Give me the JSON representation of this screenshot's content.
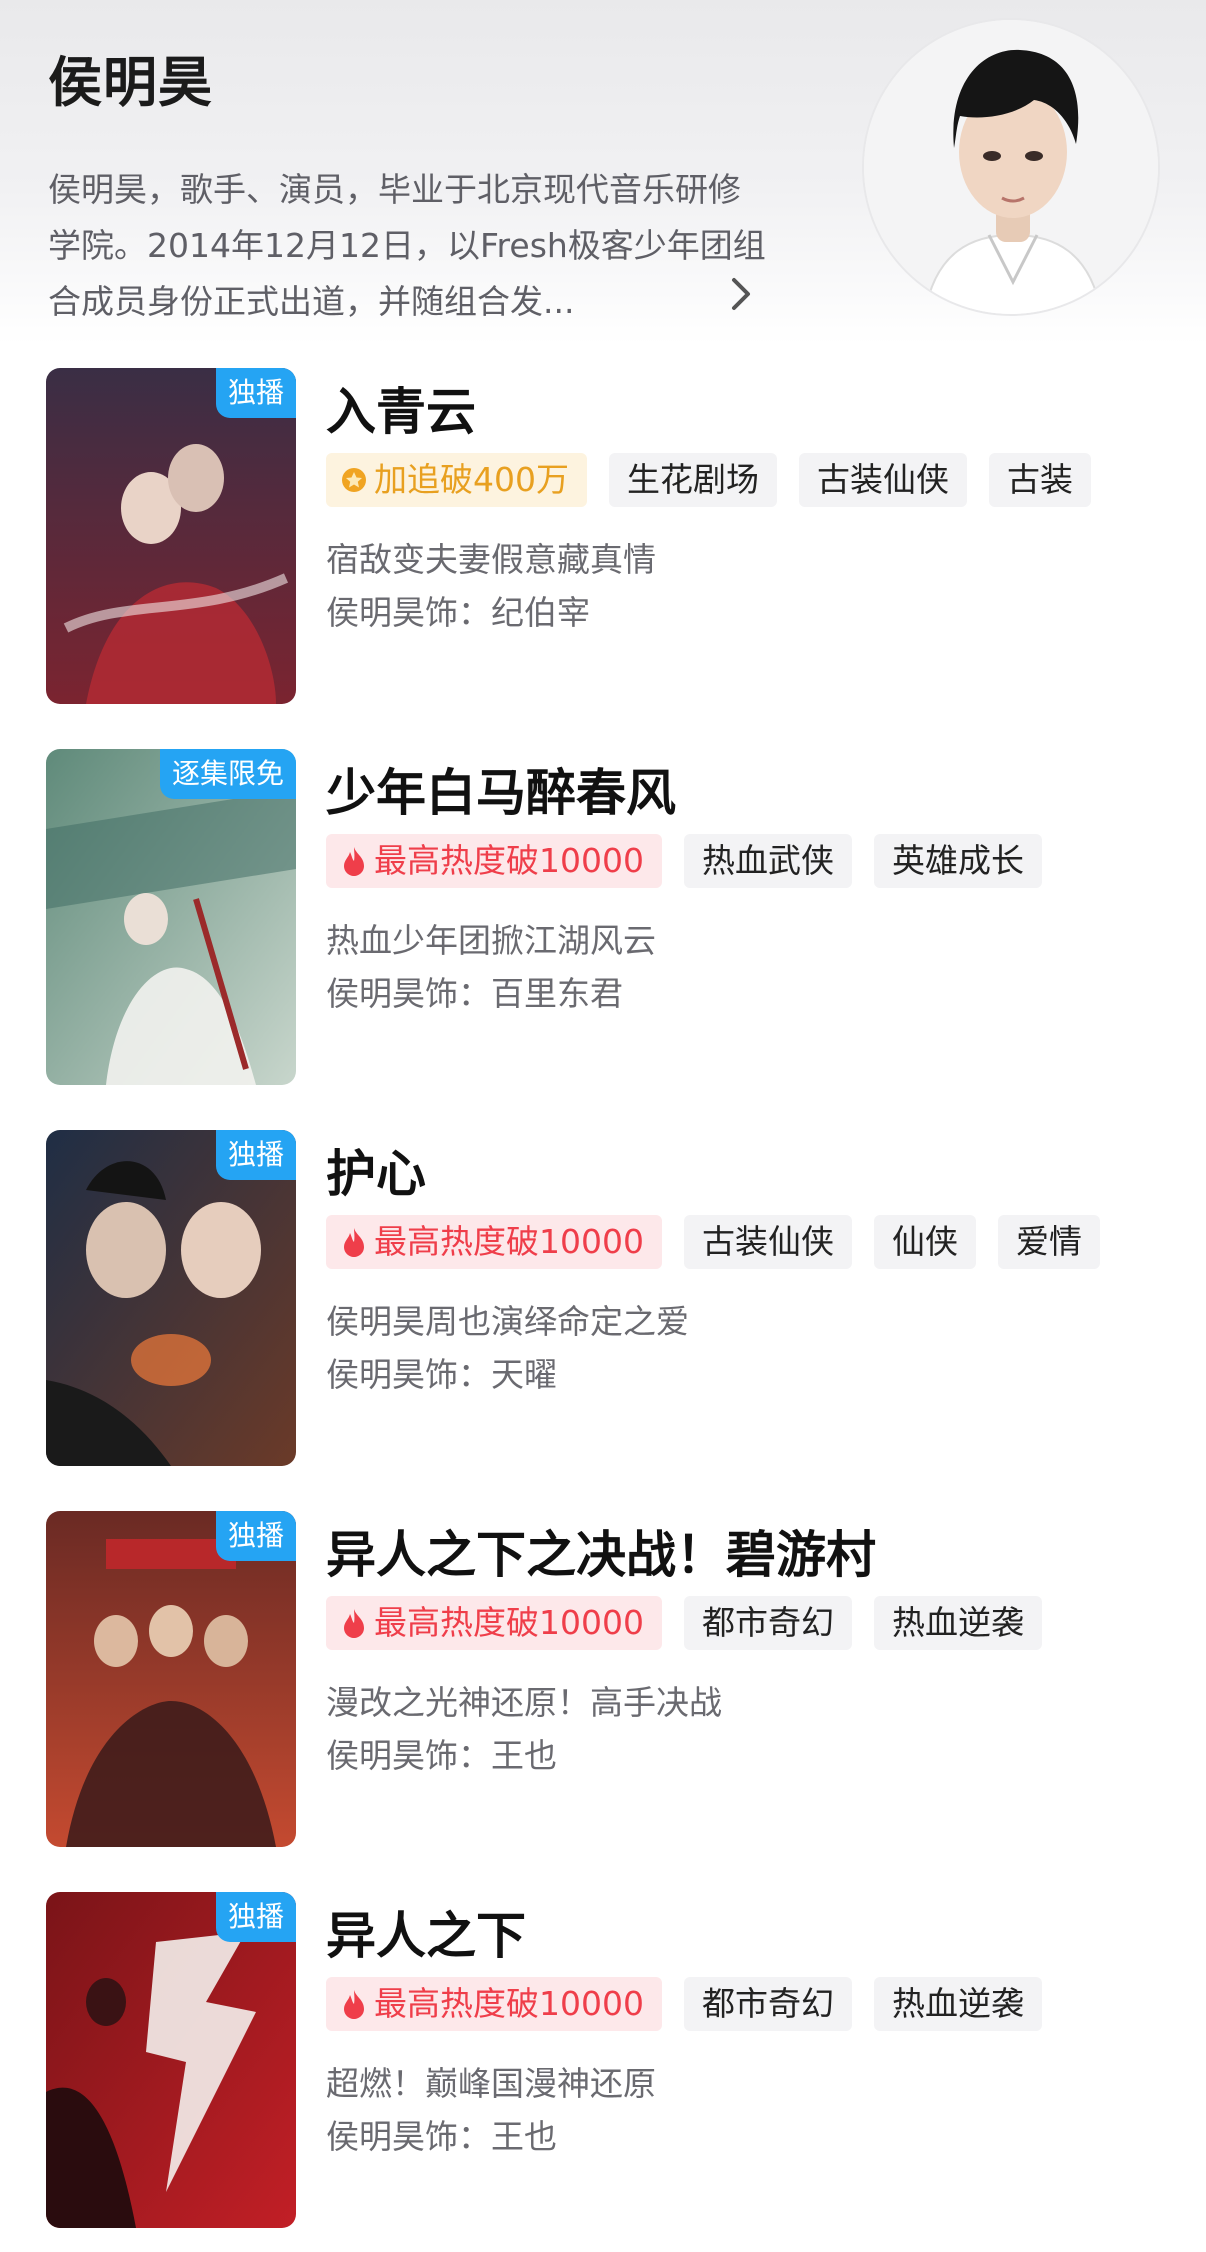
{
  "star": {
    "name": "侯明昊",
    "bio": "侯明昊，歌手、演员，毕业于北京现代音乐研修学院。2014年12月12日，以Fresh极客少年团组合成员身份正式出道，并随组合发..."
  },
  "works": [
    {
      "title": "入青云",
      "badge": "独播",
      "hot": {
        "text": "加追破400万",
        "style": "gold",
        "icon": "medal-icon"
      },
      "tags": [
        "生花剧场",
        "古装仙侠",
        "古装"
      ],
      "desc": "宿敌变夫妻假意藏真情",
      "role": "侯明昊饰：纪伯宰",
      "poster_colors": [
        "#3a2e45",
        "#7b2430"
      ]
    },
    {
      "title": "少年白马醉春风",
      "badge": "逐集限免",
      "hot": {
        "text": "最高热度破10000",
        "style": "red",
        "icon": "flame-icon"
      },
      "tags": [
        "热血武侠",
        "英雄成长"
      ],
      "desc": "热血少年团掀江湖风云",
      "role": "侯明昊饰：百里东君",
      "poster_colors": [
        "#5f8a7a",
        "#c8d6cc"
      ]
    },
    {
      "title": "护心",
      "badge": "独播",
      "hot": {
        "text": "最高热度破10000",
        "style": "red",
        "icon": "flame-icon"
      },
      "tags": [
        "古装仙侠",
        "仙侠",
        "爱情"
      ],
      "desc": "侯明昊周也演绎命定之爱",
      "role": "侯明昊饰：天曜",
      "poster_colors": [
        "#1f2e45",
        "#6b3a28"
      ]
    },
    {
      "title": "异人之下之决战！碧游村",
      "badge": "独播",
      "hot": {
        "text": "最高热度破10000",
        "style": "red",
        "icon": "flame-icon"
      },
      "tags": [
        "都市奇幻",
        "热血逆袭"
      ],
      "desc": "漫改之光神还原！高手决战",
      "role": "侯明昊饰：王也",
      "poster_colors": [
        "#6a2a24",
        "#c44a30"
      ]
    },
    {
      "title": "异人之下",
      "badge": "独播",
      "hot": {
        "text": "最高热度破10000",
        "style": "red",
        "icon": "flame-icon"
      },
      "tags": [
        "都市奇幻",
        "热血逆袭"
      ],
      "desc": "超燃！巅峰国漫神还原",
      "role": "侯明昊饰：王也",
      "poster_colors": [
        "#7a1418",
        "#c21f26"
      ]
    }
  ]
}
